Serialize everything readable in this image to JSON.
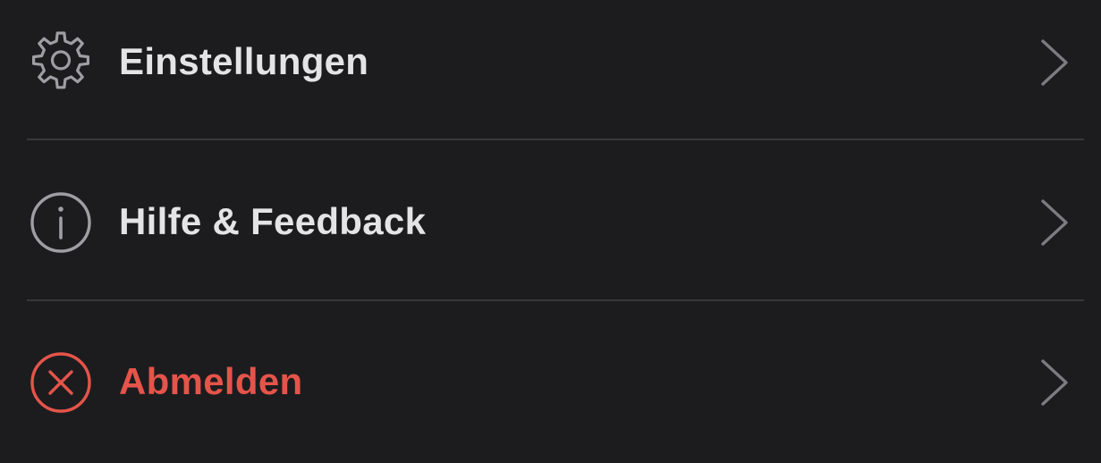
{
  "menu": {
    "items": [
      {
        "label": "Einstellungen",
        "icon": "gear-icon",
        "style": "default"
      },
      {
        "label": "Hilfe & Feedback",
        "icon": "info-icon",
        "style": "default"
      },
      {
        "label": "Abmelden",
        "icon": "close-circle-icon",
        "style": "destructive"
      }
    ]
  },
  "colors": {
    "background": "#1c1c1e",
    "text": "#e4e4e6",
    "icon": "#9e9ea3",
    "destructive": "#e5544a",
    "divider": "#38383a",
    "chevron": "#7c7c80"
  }
}
